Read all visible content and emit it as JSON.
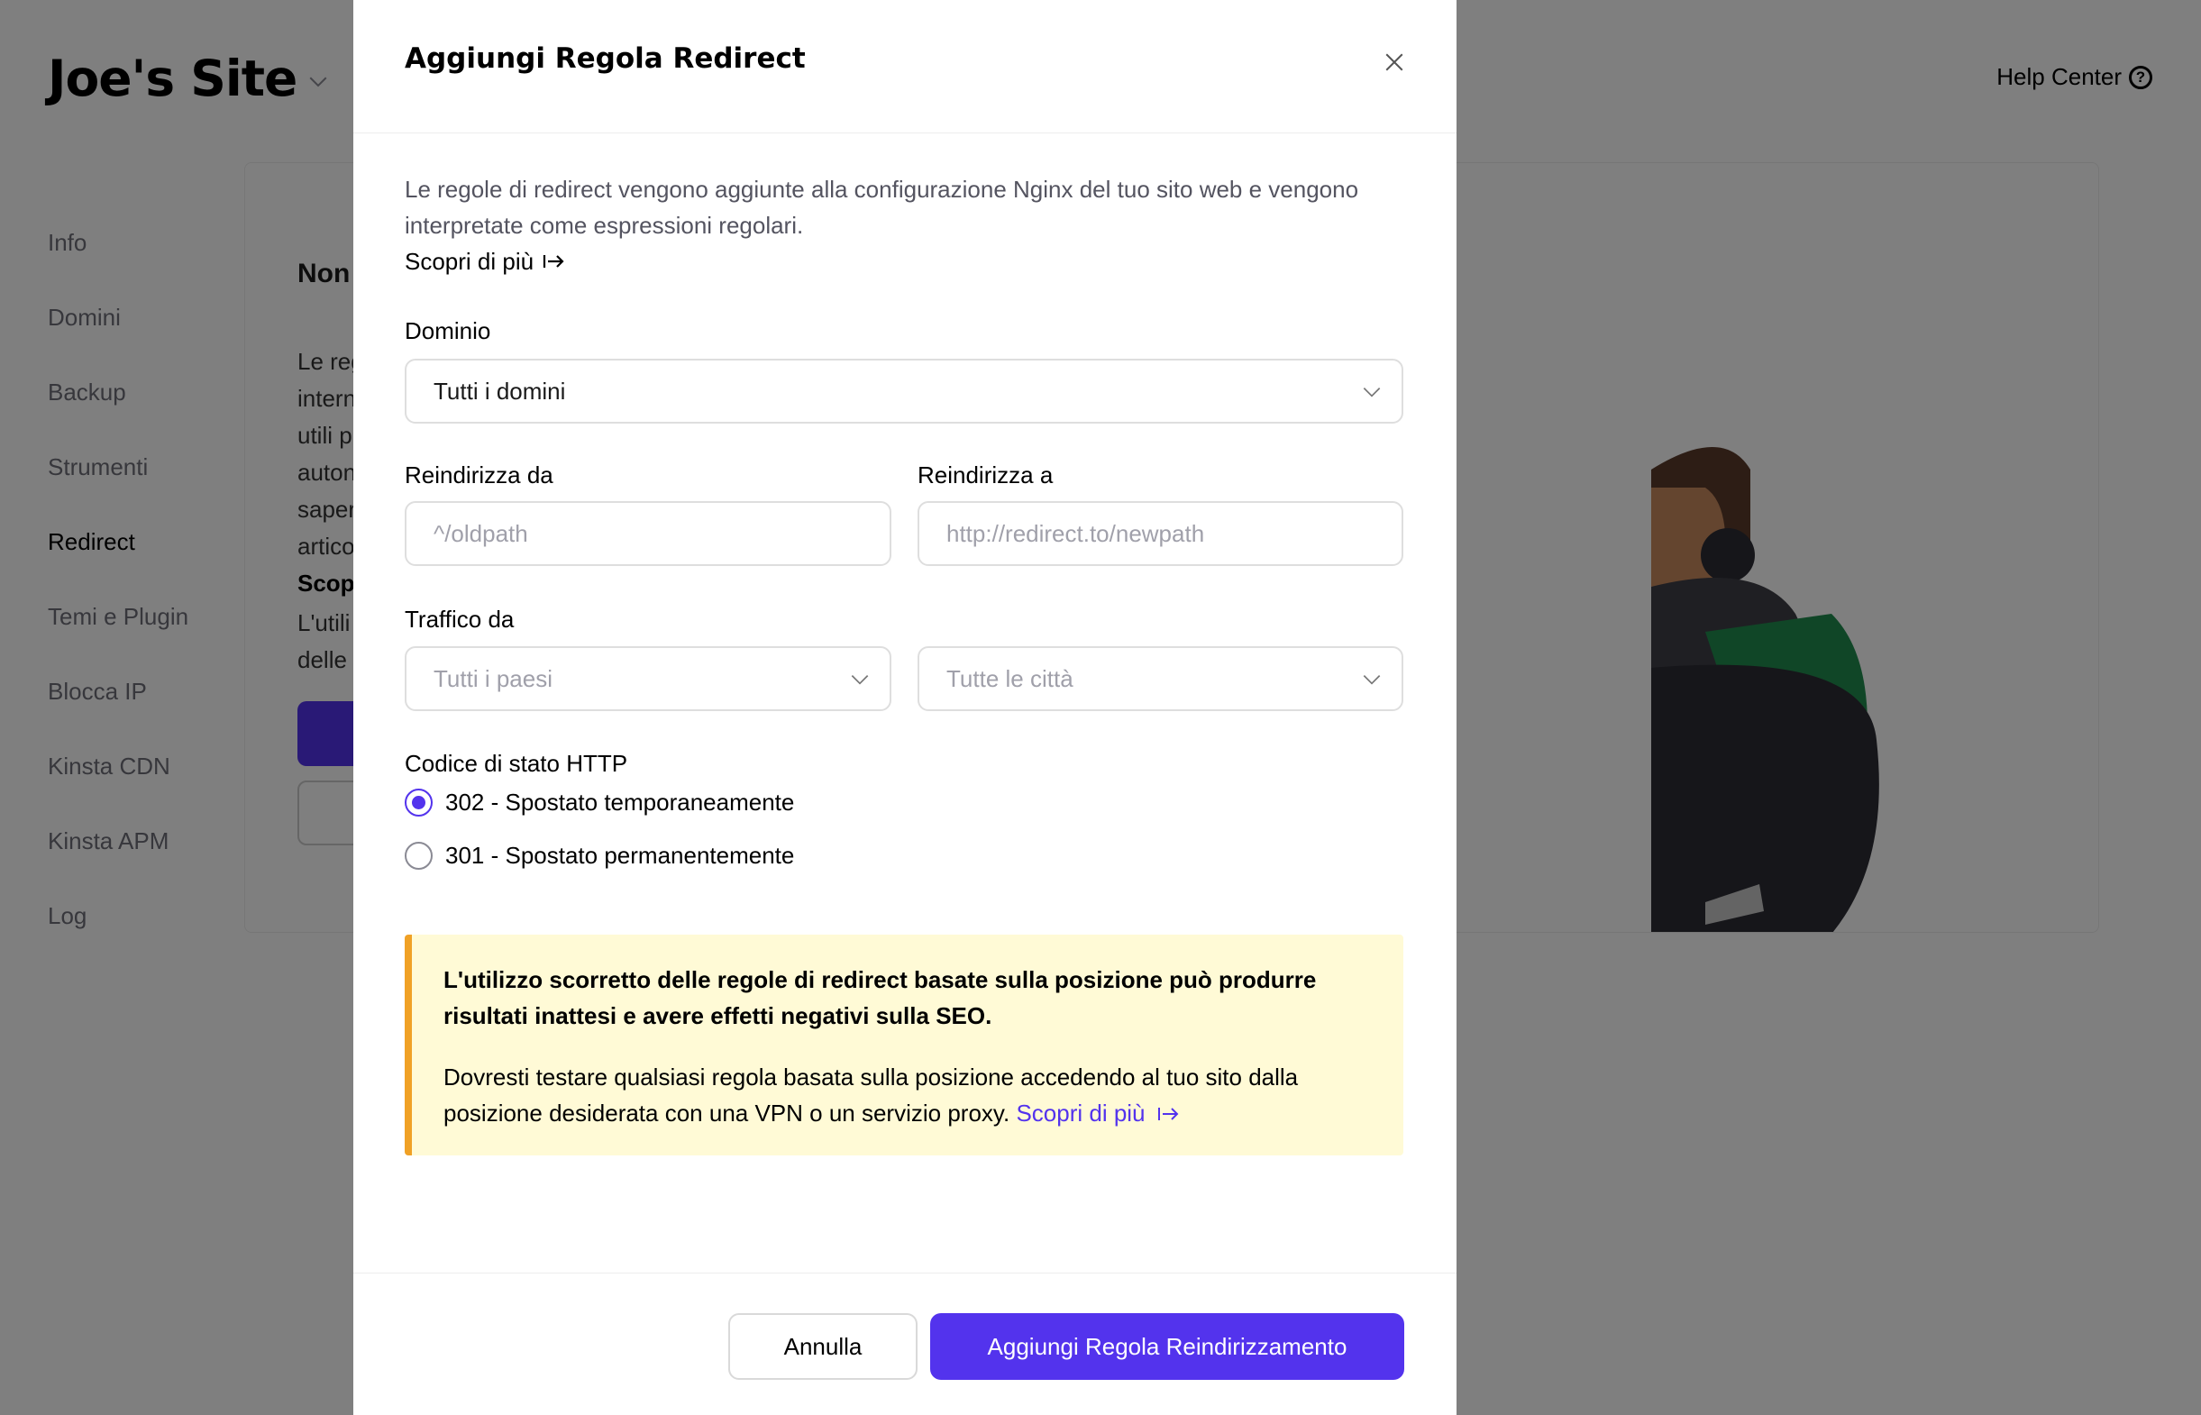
{
  "header": {
    "site_name": "Joe's Site",
    "help_center": "Help Center",
    "help_icon_glyph": "?"
  },
  "sidebar": {
    "items": [
      {
        "label": "Info"
      },
      {
        "label": "Domini"
      },
      {
        "label": "Backup"
      },
      {
        "label": "Strumenti"
      },
      {
        "label": "Redirect",
        "active": true
      },
      {
        "label": "Temi e Plugin"
      },
      {
        "label": "Blocca IP"
      },
      {
        "label": "Kinsta CDN"
      },
      {
        "label": "Kinsta APM"
      },
      {
        "label": "Log"
      }
    ]
  },
  "background": {
    "heading_fragment": "Non",
    "para_fragments": [
      "Le reg",
      "intern",
      "utili p",
      "auton",
      "saper",
      "artico",
      "Scop"
    ],
    "para2_fragments": [
      "L'utili",
      "delle"
    ]
  },
  "modal": {
    "title": "Aggiungi Regola Redirect",
    "description": "Le regole di redirect vengono aggiunte alla configurazione Nginx del tuo sito web e vengono interpretate come espressioni regolari.",
    "learn_more": "Scopri di più",
    "domain": {
      "label": "Dominio",
      "value": "Tutti i domini"
    },
    "redirect_from": {
      "label": "Reindirizza da",
      "placeholder": "^/oldpath"
    },
    "redirect_to": {
      "label": "Reindirizza a",
      "placeholder": "http://redirect.to/newpath"
    },
    "traffic": {
      "label": "Traffico da",
      "country_placeholder": "Tutti i paesi",
      "city_placeholder": "Tutte le città"
    },
    "status_code": {
      "label": "Codice di stato HTTP",
      "options": [
        {
          "label": "302 - Spostato temporaneamente",
          "checked": true
        },
        {
          "label": "301 - Spostato permanentemente",
          "checked": false
        }
      ]
    },
    "warning": {
      "title": "L'utilizzo scorretto delle regole di redirect basate sulla posizione può produrre risultati inattesi e avere effetti negativi sulla SEO.",
      "text": "Dovresti testare qualsiasi regola basata sulla posizione accedendo al tuo sito dalla posizione desiderata con una VPN o un servizio proxy.",
      "link": "Scopri di più"
    },
    "buttons": {
      "cancel": "Annulla",
      "submit": "Aggiungi Regola Reindirizzamento"
    }
  },
  "colors": {
    "accent": "#5333ed",
    "warning_bg": "#fffad6",
    "warning_border": "#f0a126"
  }
}
